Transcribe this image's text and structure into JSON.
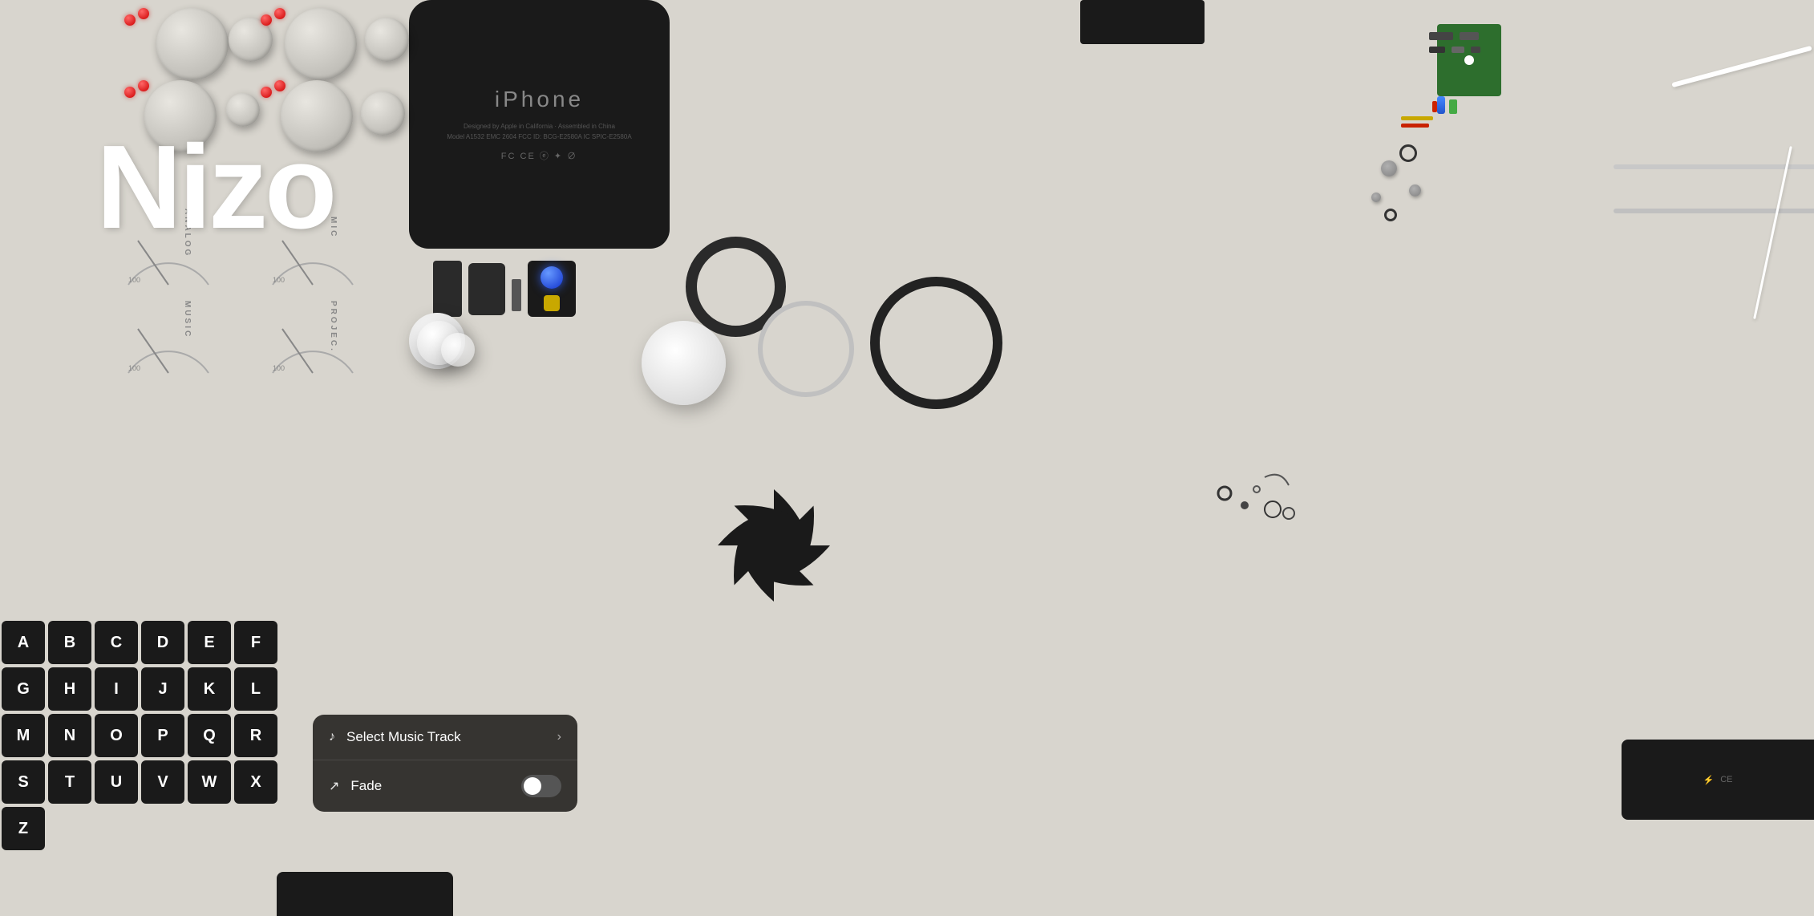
{
  "app": {
    "name": "Nizo",
    "logo": "Nizo"
  },
  "iphone": {
    "brand": "iPhone",
    "line1": "Designed by Apple in California · Assembled in China",
    "line2": "Model A1532 EMC 2604 FCC ID: BCG-E2580A IC SPIC-E2580A",
    "logos": "FC CE ⓔ ✦ ∅"
  },
  "labels": {
    "analog": "ANALOG",
    "mic": "MIC",
    "music": "MUSIC",
    "proj": "PROJEC.",
    "val100_1": "100",
    "val100_2": "100",
    "val100_3": "100",
    "val100_4": "100"
  },
  "keyboard": {
    "rows": [
      [
        "A",
        "B",
        "C",
        "D",
        "E",
        "F"
      ],
      [
        "G",
        "H",
        "I",
        "J",
        "K",
        "L"
      ],
      [
        "M",
        "N",
        "O",
        "P",
        "Q",
        "R"
      ],
      [
        "S",
        "T",
        "U",
        "V",
        "W",
        "X"
      ],
      [
        "Z"
      ]
    ]
  },
  "menu": {
    "items": [
      {
        "icon": "♪",
        "label": "Select Music Track",
        "type": "arrow",
        "arrow": "›"
      },
      {
        "icon": "↗",
        "label": "Fade",
        "type": "toggle"
      }
    ]
  }
}
